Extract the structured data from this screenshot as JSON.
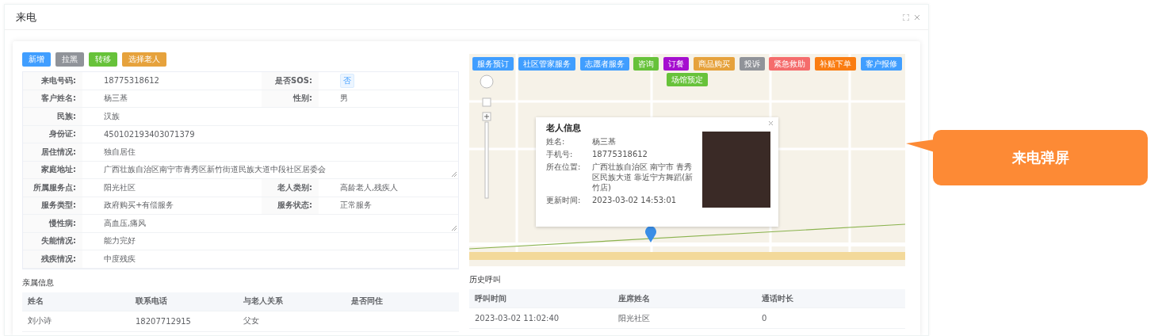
{
  "window": {
    "title": "来电"
  },
  "toolbar": [
    {
      "label": "新增",
      "color": "#409eff"
    },
    {
      "label": "拉黑",
      "color": "#909399"
    },
    {
      "label": "转移",
      "color": "#67c23a"
    },
    {
      "label": "选择老人",
      "color": "#e6a23c"
    }
  ],
  "form_rows": [
    [
      {
        "label": "来电号码:",
        "value": "18775318612",
        "kind": "text"
      },
      {
        "label": "是否SOS:",
        "value": "否",
        "kind": "tag"
      }
    ],
    [
      {
        "label": "客户姓名:",
        "value": "杨三基",
        "kind": "text"
      },
      {
        "label": "性别:",
        "value": "男",
        "kind": "text"
      }
    ],
    [
      {
        "label": "民族:",
        "value": "汉族",
        "kind": "text"
      }
    ],
    [
      {
        "label": "身份证:",
        "value": "450102193403071379",
        "kind": "text"
      }
    ],
    [
      {
        "label": "居住情况:",
        "value": "独自居住",
        "kind": "text"
      }
    ],
    [
      {
        "label": "家庭地址:",
        "value": "广西壮族自治区南宁市青秀区新竹街道民族大道中段社区居委会",
        "kind": "textarea"
      }
    ],
    [
      {
        "label": "所属服务点:",
        "value": "阳光社区",
        "kind": "text"
      },
      {
        "label": "老人类别:",
        "value": "高龄老人,残疾人",
        "kind": "text"
      }
    ],
    [
      {
        "label": "服务类型:",
        "value": "政府购买+有偿服务",
        "kind": "text"
      },
      {
        "label": "服务状态:",
        "value": "正常服务",
        "kind": "text"
      }
    ],
    [
      {
        "label": "慢性病:",
        "value": "高血压,痛风",
        "kind": "textarea"
      }
    ],
    [
      {
        "label": "失能情况:",
        "value": "能力完好",
        "kind": "text"
      }
    ],
    [
      {
        "label": "残疾情况:",
        "value": "中度残疾",
        "kind": "text"
      }
    ]
  ],
  "map_actions": [
    {
      "label": "服务预订",
      "color": "#409eff"
    },
    {
      "label": "社区管家服务",
      "color": "#409eff"
    },
    {
      "label": "志愿者服务",
      "color": "#409eff"
    },
    {
      "label": "咨询",
      "color": "#67c23a"
    },
    {
      "label": "订餐",
      "color": "#a50fcf"
    },
    {
      "label": "商品购买",
      "color": "#e6a23c"
    },
    {
      "label": "投诉",
      "color": "#909399"
    },
    {
      "label": "紧急救助",
      "color": "#f56c6c"
    },
    {
      "label": "补贴下单",
      "color": "#fa7d12"
    },
    {
      "label": "客户报修",
      "color": "#409eff"
    },
    {
      "label": "场馆预定",
      "color": "#67c23a"
    }
  ],
  "popup": {
    "title": "老人信息",
    "fields": [
      {
        "label": "姓名:",
        "value": "杨三基"
      },
      {
        "label": "手机号:",
        "value": "18775318612"
      },
      {
        "label": "所在位置:",
        "value": "广西壮族自治区 南宁市 青秀区民族大道 靠近宁方舞蹈(新竹店)"
      },
      {
        "label": "更新时间:",
        "value": "2023-03-02 14:53:01"
      }
    ]
  },
  "relatives": {
    "title": "亲属信息",
    "columns": [
      "姓名",
      "联系电话",
      "与老人关系",
      "是否同住"
    ],
    "rows": [
      [
        "刘小诗",
        "18207712915",
        "父女"
      ]
    ]
  },
  "call_history": {
    "title": "历史呼叫",
    "columns": [
      "呼叫时间",
      "座席姓名",
      "通话时长"
    ],
    "rows": [
      [
        "2023-03-02 11:02:40",
        "阳光社区",
        "0"
      ]
    ]
  },
  "callout": {
    "text": "来电弹屏"
  }
}
